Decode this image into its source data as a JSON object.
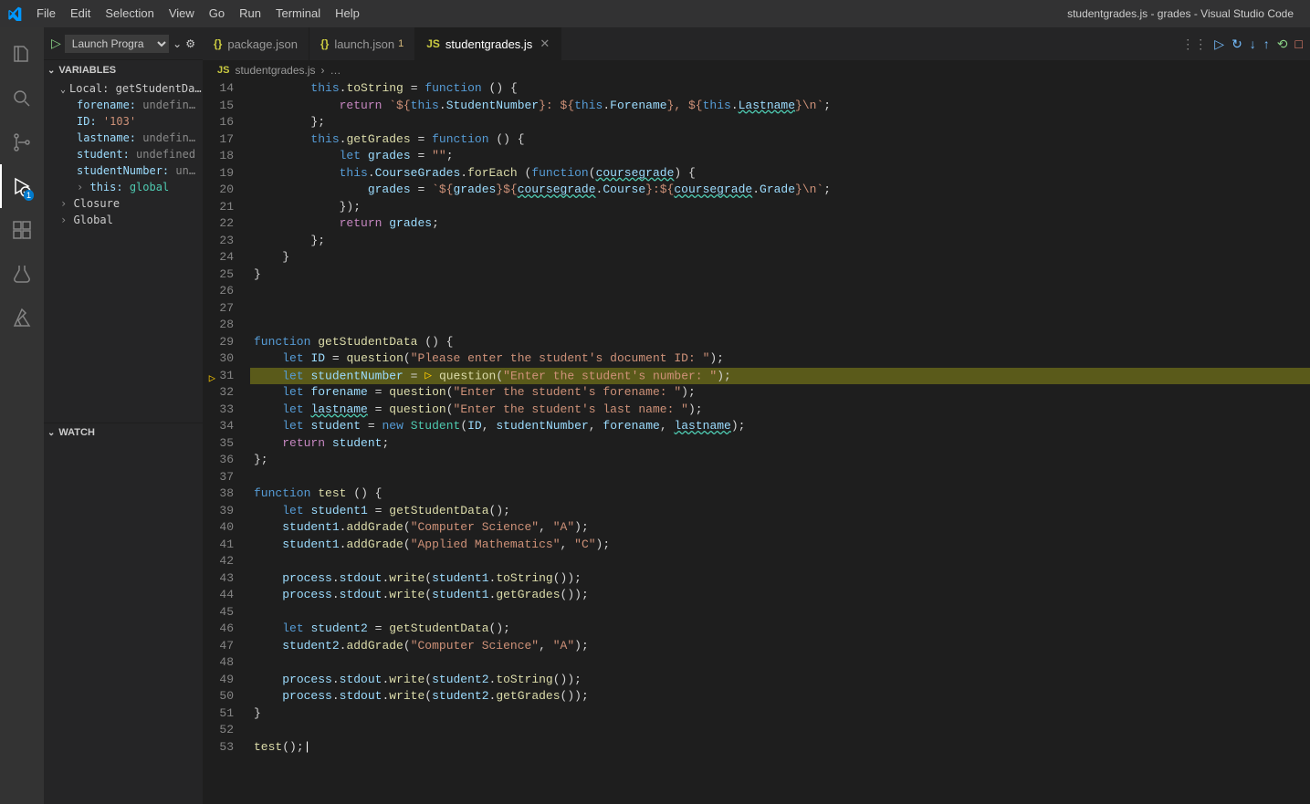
{
  "titlebar": {
    "menus": [
      "File",
      "Edit",
      "Selection",
      "View",
      "Go",
      "Run",
      "Terminal",
      "Help"
    ],
    "title": "studentgrades.js - grades - Visual Studio Code"
  },
  "activitybar": {
    "items": [
      {
        "name": "files-icon"
      },
      {
        "name": "search-icon"
      },
      {
        "name": "source-control-icon"
      },
      {
        "name": "run-debug-icon",
        "active": true,
        "badge": "1"
      },
      {
        "name": "extensions-icon"
      },
      {
        "name": "testing-icon"
      },
      {
        "name": "azure-icon"
      }
    ]
  },
  "sidebar": {
    "launch_label": "Launch Progra",
    "sections": {
      "variables": "VARIABLES",
      "watch": "WATCH"
    },
    "local_label": "Local: getStudentData",
    "variables": [
      {
        "key": "forename:",
        "val": "undefin…",
        "cls": "undef"
      },
      {
        "key": "ID:",
        "val": "'103'",
        "cls": "str"
      },
      {
        "key": "lastname:",
        "val": "undefin…",
        "cls": "undef"
      },
      {
        "key": "student:",
        "val": "undefined",
        "cls": "undef"
      },
      {
        "key": "studentNumber:",
        "val": "un…",
        "cls": "undef"
      }
    ],
    "this_label": "this: ",
    "this_val": "global",
    "closure": "Closure",
    "global": "Global"
  },
  "tabs": [
    {
      "icon": "{}",
      "icon_cls": "js-icon",
      "style": "color:#cbcb41",
      "label": "package.json",
      "modified": false
    },
    {
      "icon": "{}",
      "icon_cls": "js-icon",
      "style": "color:#cbcb41",
      "label": "launch.json",
      "modified": true,
      "mod_text": "1"
    },
    {
      "icon": "JS",
      "icon_cls": "js-icon",
      "label": "studentgrades.js",
      "active": true,
      "closable": true
    }
  ],
  "breadcrumb": {
    "file_icon": "JS",
    "file": "studentgrades.js",
    "sep": "›",
    "symbol": "…"
  },
  "debug_toolbar": {
    "items": [
      "grip",
      "continue",
      "step-over",
      "step-into",
      "step-out",
      "restart",
      "stop"
    ]
  },
  "code": {
    "start": 14,
    "current": 31,
    "lines": [
      "        <span class='tk-this'>this</span><span class='tk-p'>.</span><span class='tk-fn'>toString</span> <span class='tk-p'>=</span> <span class='tk-kw'>function</span> <span class='tk-p'>() {</span>",
      "            <span class='tk-kw2'>return</span> <span class='tk-str'>`${</span><span class='tk-this'>this</span><span class='tk-p'>.</span><span class='tk-var'>StudentNumber</span><span class='tk-str'>}: ${</span><span class='tk-this'>this</span><span class='tk-p'>.</span><span class='tk-var'>Forename</span><span class='tk-str'>}, ${</span><span class='tk-this'>this</span><span class='tk-p'>.</span><span class='tk-var tk-uw'>Lastname</span><span class='tk-str'>}\\n`</span><span class='tk-p'>;</span>",
      "        <span class='tk-p'>};</span>",
      "        <span class='tk-this'>this</span><span class='tk-p'>.</span><span class='tk-fn'>getGrades</span> <span class='tk-p'>=</span> <span class='tk-kw'>function</span> <span class='tk-p'>() {</span>",
      "            <span class='tk-kw'>let</span> <span class='tk-var'>grades</span> <span class='tk-p'>=</span> <span class='tk-str'>\"\"</span><span class='tk-p'>;</span>",
      "            <span class='tk-this'>this</span><span class='tk-p'>.</span><span class='tk-var'>CourseGrades</span><span class='tk-p'>.</span><span class='tk-fn'>forEach</span> <span class='tk-p'>(</span><span class='tk-kw'>function</span><span class='tk-p'>(</span><span class='tk-var tk-uw'>coursegrade</span><span class='tk-p'>) {</span>",
      "                <span class='tk-var'>grades</span> <span class='tk-p'>=</span> <span class='tk-str'>`${</span><span class='tk-var'>grades</span><span class='tk-str'>}${</span><span class='tk-var tk-uw'>coursegrade</span><span class='tk-p'>.</span><span class='tk-var'>Course</span><span class='tk-str'>}:${</span><span class='tk-var tk-uw'>coursegrade</span><span class='tk-p'>.</span><span class='tk-var'>Grade</span><span class='tk-str'>}\\n`</span><span class='tk-p'>;</span>",
      "            <span class='tk-p'>});</span>",
      "            <span class='tk-kw2'>return</span> <span class='tk-var'>grades</span><span class='tk-p'>;</span>",
      "        <span class='tk-p'>};</span>",
      "    <span class='tk-p'>}</span>",
      "<span class='tk-p'>}</span>",
      "",
      "",
      "",
      "<span class='tk-kw'>function</span> <span class='tk-fn'>getStudentData</span> <span class='tk-p'>() {</span>",
      "    <span class='tk-kw'>let</span> <span class='tk-var'>ID</span> <span class='tk-p'>=</span> <span class='tk-fn'>question</span><span class='tk-p'>(</span><span class='tk-str'>\"Please enter the student's document ID: \"</span><span class='tk-p'>);</span>",
      "    <span class='tk-kw'>let</span> <span class='tk-var'>studentNumber</span> <span class='tk-p'>=</span> <span class='hl-marker'>▷</span> <span class='tk-fn'>question</span><span class='tk-p'>(</span><span class='tk-str'>\"Enter the student's number: \"</span><span class='tk-p'>);</span>",
      "    <span class='tk-kw'>let</span> <span class='tk-var'>forename</span> <span class='tk-p'>=</span> <span class='tk-fn'>question</span><span class='tk-p'>(</span><span class='tk-str'>\"Enter the student's forename: \"</span><span class='tk-p'>);</span>",
      "    <span class='tk-kw'>let</span> <span class='tk-var tk-uw'>lastname</span> <span class='tk-p'>=</span> <span class='tk-fn'>question</span><span class='tk-p'>(</span><span class='tk-str'>\"Enter the student's last name: \"</span><span class='tk-p'>);</span>",
      "    <span class='tk-kw'>let</span> <span class='tk-var'>student</span> <span class='tk-p'>=</span> <span class='tk-kw'>new</span> <span class='tk-type'>Student</span><span class='tk-p'>(</span><span class='tk-var'>ID</span><span class='tk-p'>,</span> <span class='tk-var'>studentNumber</span><span class='tk-p'>,</span> <span class='tk-var'>forename</span><span class='tk-p'>,</span> <span class='tk-var tk-uw'>lastname</span><span class='tk-p'>);</span>",
      "    <span class='tk-kw2'>return</span> <span class='tk-var'>student</span><span class='tk-p'>;</span>",
      "<span class='tk-p'>};</span>",
      "",
      "<span class='tk-kw'>function</span> <span class='tk-fn'>test</span> <span class='tk-p'>() {</span>",
      "    <span class='tk-kw'>let</span> <span class='tk-var'>student1</span> <span class='tk-p'>=</span> <span class='tk-fn'>getStudentData</span><span class='tk-p'>();</span>",
      "    <span class='tk-var'>student1</span><span class='tk-p'>.</span><span class='tk-fn'>addGrade</span><span class='tk-p'>(</span><span class='tk-str'>\"Computer Science\"</span><span class='tk-p'>,</span> <span class='tk-str'>\"A\"</span><span class='tk-p'>);</span>",
      "    <span class='tk-var'>student1</span><span class='tk-p'>.</span><span class='tk-fn'>addGrade</span><span class='tk-p'>(</span><span class='tk-str'>\"Applied Mathematics\"</span><span class='tk-p'>,</span> <span class='tk-str'>\"C\"</span><span class='tk-p'>);</span>",
      "",
      "    <span class='tk-var'>process</span><span class='tk-p'>.</span><span class='tk-var'>stdout</span><span class='tk-p'>.</span><span class='tk-fn'>write</span><span class='tk-p'>(</span><span class='tk-var'>student1</span><span class='tk-p'>.</span><span class='tk-fn'>toString</span><span class='tk-p'>());</span>",
      "    <span class='tk-var'>process</span><span class='tk-p'>.</span><span class='tk-var'>stdout</span><span class='tk-p'>.</span><span class='tk-fn'>write</span><span class='tk-p'>(</span><span class='tk-var'>student1</span><span class='tk-p'>.</span><span class='tk-fn'>getGrades</span><span class='tk-p'>());</span>",
      "",
      "    <span class='tk-kw'>let</span> <span class='tk-var'>student2</span> <span class='tk-p'>=</span> <span class='tk-fn'>getStudentData</span><span class='tk-p'>();</span>",
      "    <span class='tk-var'>student2</span><span class='tk-p'>.</span><span class='tk-fn'>addGrade</span><span class='tk-p'>(</span><span class='tk-str'>\"Computer Science\"</span><span class='tk-p'>,</span> <span class='tk-str'>\"A\"</span><span class='tk-p'>);</span>",
      "",
      "    <span class='tk-var'>process</span><span class='tk-p'>.</span><span class='tk-var'>stdout</span><span class='tk-p'>.</span><span class='tk-fn'>write</span><span class='tk-p'>(</span><span class='tk-var'>student2</span><span class='tk-p'>.</span><span class='tk-fn'>toString</span><span class='tk-p'>());</span>",
      "    <span class='tk-var'>process</span><span class='tk-p'>.</span><span class='tk-var'>stdout</span><span class='tk-p'>.</span><span class='tk-fn'>write</span><span class='tk-p'>(</span><span class='tk-var'>student2</span><span class='tk-p'>.</span><span class='tk-fn'>getGrades</span><span class='tk-p'>());</span>",
      "<span class='tk-p'>}</span>",
      "",
      "<span class='tk-fn'>test</span><span class='tk-p'>();</span><span class='cursor-caret'></span>"
    ]
  }
}
